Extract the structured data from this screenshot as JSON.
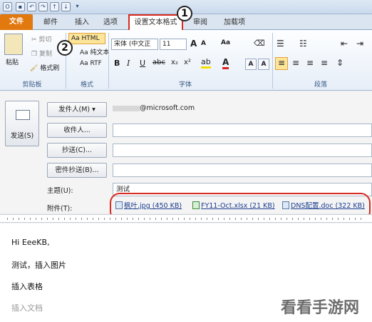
{
  "tabs": {
    "file": "文件",
    "mail": "邮件",
    "insert": "插入",
    "options": "选项",
    "format_text": "设置文本格式",
    "review": "审阅",
    "addins": "加载项"
  },
  "ribbon": {
    "clipboard": {
      "label": "剪贴板",
      "paste": "粘贴",
      "cut": "剪切",
      "copy": "复制",
      "format_painter": "格式刷"
    },
    "format": {
      "label": "格式",
      "html": "Aa HTML",
      "plain": "Aa 纯文本",
      "rtf": "Aa RTF"
    },
    "font": {
      "label": "字体",
      "font_name": "宋体 (中文正",
      "font_size": "11",
      "grow": "A",
      "shrink": "A",
      "case": "Aa"
    },
    "paragraph": {
      "label": "段落"
    }
  },
  "compose": {
    "send": "发送(S)",
    "from_button": "发件人(M)",
    "from_value": "@microsoft.com",
    "to_button": "收件人...",
    "cc_button": "抄送(C)...",
    "bcc_button": "密件抄送(B)...",
    "subject_label": "主题(U):",
    "subject_value": "测试",
    "attach_label": "附件(T):",
    "attachments": [
      "枫叶.jpg (450 KB)",
      "FY11-Oct.xlsx (21 KB)",
      "DNS配置.doc (322 KB)"
    ]
  },
  "body": {
    "line1": "Hi EeeKB,",
    "line2": "测试，插入图片",
    "line3": "插入表格",
    "line4": "插入文档"
  },
  "annotations": {
    "badge1": "1",
    "badge2": "2"
  },
  "watermark": "看看手游网"
}
